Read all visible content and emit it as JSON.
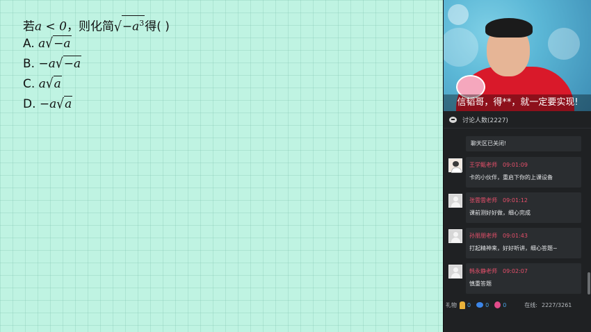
{
  "question": {
    "prefix": "若",
    "condition": "a < 0",
    "middle": "，则化简",
    "radicand": "−a",
    "exponent": "3",
    "suffix": "得(        )",
    "options": [
      {
        "label": "A.",
        "coef": "a",
        "radicand": "−a"
      },
      {
        "label": "B.",
        "coef": "−a",
        "radicand": "−a"
      },
      {
        "label": "C.",
        "coef": "a",
        "radicand": "a"
      },
      {
        "label": "D.",
        "coef": "−a",
        "radicand": "a"
      }
    ]
  },
  "video": {
    "caption": "信韬哥，得**，就一定要实现!"
  },
  "chat": {
    "header": "讨论人数(2227)",
    "system_message": "聊天区已关闭!",
    "messages": [
      {
        "name": "王学甄老师",
        "time": "09:01:09",
        "text": "卡的小伙伴，重启下你的上课设备",
        "avatar": "person"
      },
      {
        "name": "张雲雲老师",
        "time": "09:01:12",
        "text": "课前测好好做，细心完成",
        "avatar": "blank"
      },
      {
        "name": "孙朋朋老师",
        "time": "09:01:43",
        "text": "打起精神来，好好听讲，细心答题~",
        "avatar": "blank"
      },
      {
        "name": "韩永静老师",
        "time": "09:02:07",
        "text": "慎重答题",
        "avatar": "blank"
      }
    ]
  },
  "footer": {
    "gift_label": "礼物",
    "gifts": [
      {
        "icon": "trophy-icon",
        "count": "0",
        "color": "#e9b23a"
      },
      {
        "icon": "planet-icon",
        "count": "0",
        "color": "#3c86e8"
      },
      {
        "icon": "balloons-icon",
        "count": "0",
        "color": "#e24b8a"
      }
    ],
    "online_label": "在线:",
    "online_value": "2227/3261"
  }
}
